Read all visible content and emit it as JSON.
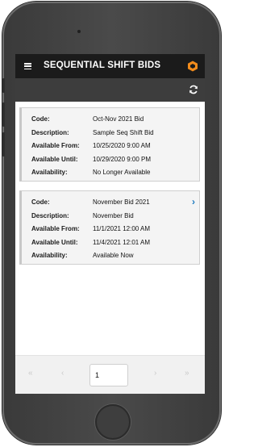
{
  "app": {
    "title": "SEQUENTIAL SHIFT BIDS",
    "menu_icon": "hamburger-icon",
    "logo_icon": "hexagon-logo-icon",
    "refresh_icon": "refresh-icon"
  },
  "labels": {
    "code": "Code:",
    "description": "Description:",
    "available_from": "Available From:",
    "available_until": "Available Until:",
    "availability": "Availability:"
  },
  "bids": [
    {
      "code": "Oct-Nov 2021 Bid",
      "description": "Sample Seq Shift Bid",
      "available_from": "10/25/2020 9:00 AM",
      "available_until": "10/29/2020 9:00 PM",
      "availability": "No Longer Available",
      "has_chevron": false
    },
    {
      "code": "November Bid 2021",
      "description": "November Bid",
      "available_from": "11/1/2021 12:00 AM",
      "available_until": "11/4/2021 12:01 AM",
      "availability": "Available Now",
      "has_chevron": true,
      "chevron": "›"
    }
  ],
  "pager": {
    "first": "«",
    "prev": "‹",
    "page_value": "1",
    "next": "›",
    "last": "»"
  },
  "colors": {
    "topbar": "#1b1b1b",
    "subbar": "#3d3d3d",
    "accent": "#1e7bbf",
    "logo": "#f28c1c"
  }
}
